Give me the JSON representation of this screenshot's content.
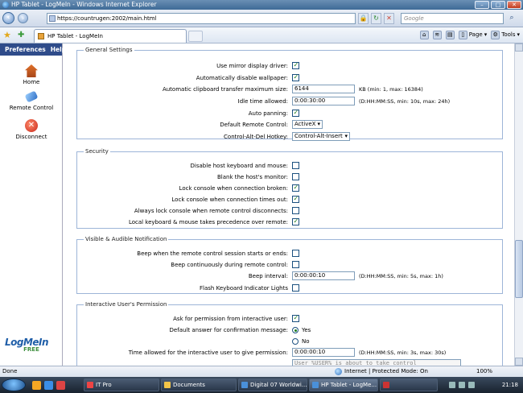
{
  "window": {
    "title": "HP Tablet - LogMeIn - Windows Internet Explorer",
    "min": "–",
    "max": "□",
    "close": "✕"
  },
  "address": {
    "url": "https://countrugen:2002/main.html",
    "search_placeholder": "Google"
  },
  "tab": {
    "title": "HP Tablet - LogMeIn"
  },
  "commands": {
    "page": "Page",
    "tools": "Tools"
  },
  "sidebar": {
    "menu": [
      "Preferences",
      "Help"
    ],
    "items": [
      {
        "label": "Home"
      },
      {
        "label": "Remote Control"
      },
      {
        "label": "Disconnect"
      }
    ],
    "logo": {
      "text": "LogMeIn",
      "sub": "FREE"
    }
  },
  "sections": {
    "general": {
      "title": "General Settings",
      "mirror_driver": {
        "label": "Use mirror display driver:",
        "checked": true
      },
      "disable_wallpaper": {
        "label": "Automatically disable wallpaper:",
        "checked": true
      },
      "clipboard_max": {
        "label": "Automatic clipboard transfer maximum size:",
        "value": "6144",
        "hint": "KB (min: 1, max: 16384)"
      },
      "idle_time": {
        "label": "Idle time allowed:",
        "value": "0:00:30:00",
        "hint": "(D:HH:MM:SS, min: 10s, max: 24h)"
      },
      "auto_panning": {
        "label": "Auto panning:",
        "checked": true
      },
      "default_remote": {
        "label": "Default Remote Control:",
        "value": "ActiveX"
      },
      "cad_hotkey": {
        "label": "Control-Alt-Del Hotkey:",
        "value": "Control-Alt-Insert"
      }
    },
    "security": {
      "title": "Security",
      "disable_host_kb": {
        "label": "Disable host keyboard and mouse:",
        "checked": false
      },
      "blank_monitor": {
        "label": "Blank the host's monitor:",
        "checked": false
      },
      "lock_broken": {
        "label": "Lock console when connection broken:",
        "checked": true
      },
      "lock_timeout": {
        "label": "Lock console when connection times out:",
        "checked": true
      },
      "always_lock": {
        "label": "Always lock console when remote control disconnects:",
        "checked": false
      },
      "local_precedence": {
        "label": "Local keyboard & mouse takes precedence over remote:",
        "checked": true
      }
    },
    "notification": {
      "title": "Visible & Audible Notification",
      "beep_start": {
        "label": "Beep when the remote control session starts or ends:",
        "checked": false
      },
      "beep_continuous": {
        "label": "Beep continuously during remote control:",
        "checked": false
      },
      "beep_interval": {
        "label": "Beep interval:",
        "value": "0:00:00:10",
        "hint": "(D:HH:MM:SS, min: 5s, max: 1h)"
      },
      "flash_lights": {
        "label": "Flash Keyboard Indicator Lights",
        "checked": false
      }
    },
    "permission": {
      "title": "Interactive User's Permission",
      "ask_permission": {
        "label": "Ask for permission from interactive user:",
        "checked": true
      },
      "default_answer": {
        "label": "Default answer for confirmation message:",
        "yes": "Yes",
        "no": "No",
        "selected": "Yes"
      },
      "time_allowed": {
        "label": "Time allowed for the interactive user to give permission:",
        "value": "0:00:00:10",
        "hint": "(D:HH:MM:SS, min: 3s, max: 30s)"
      },
      "message_preview": "User %USER% is about to take control"
    }
  },
  "status": {
    "left": "Done",
    "zone": "Internet | Protected Mode: On",
    "zoom": "100%"
  },
  "taskbar": {
    "tasks": [
      {
        "label": "IT Pro"
      },
      {
        "label": "Documents"
      },
      {
        "label": "Digital 07 Worldwi..."
      },
      {
        "label": "HP Tablet - LogMe..."
      },
      {
        "label": ""
      }
    ],
    "clock": "21:18"
  }
}
